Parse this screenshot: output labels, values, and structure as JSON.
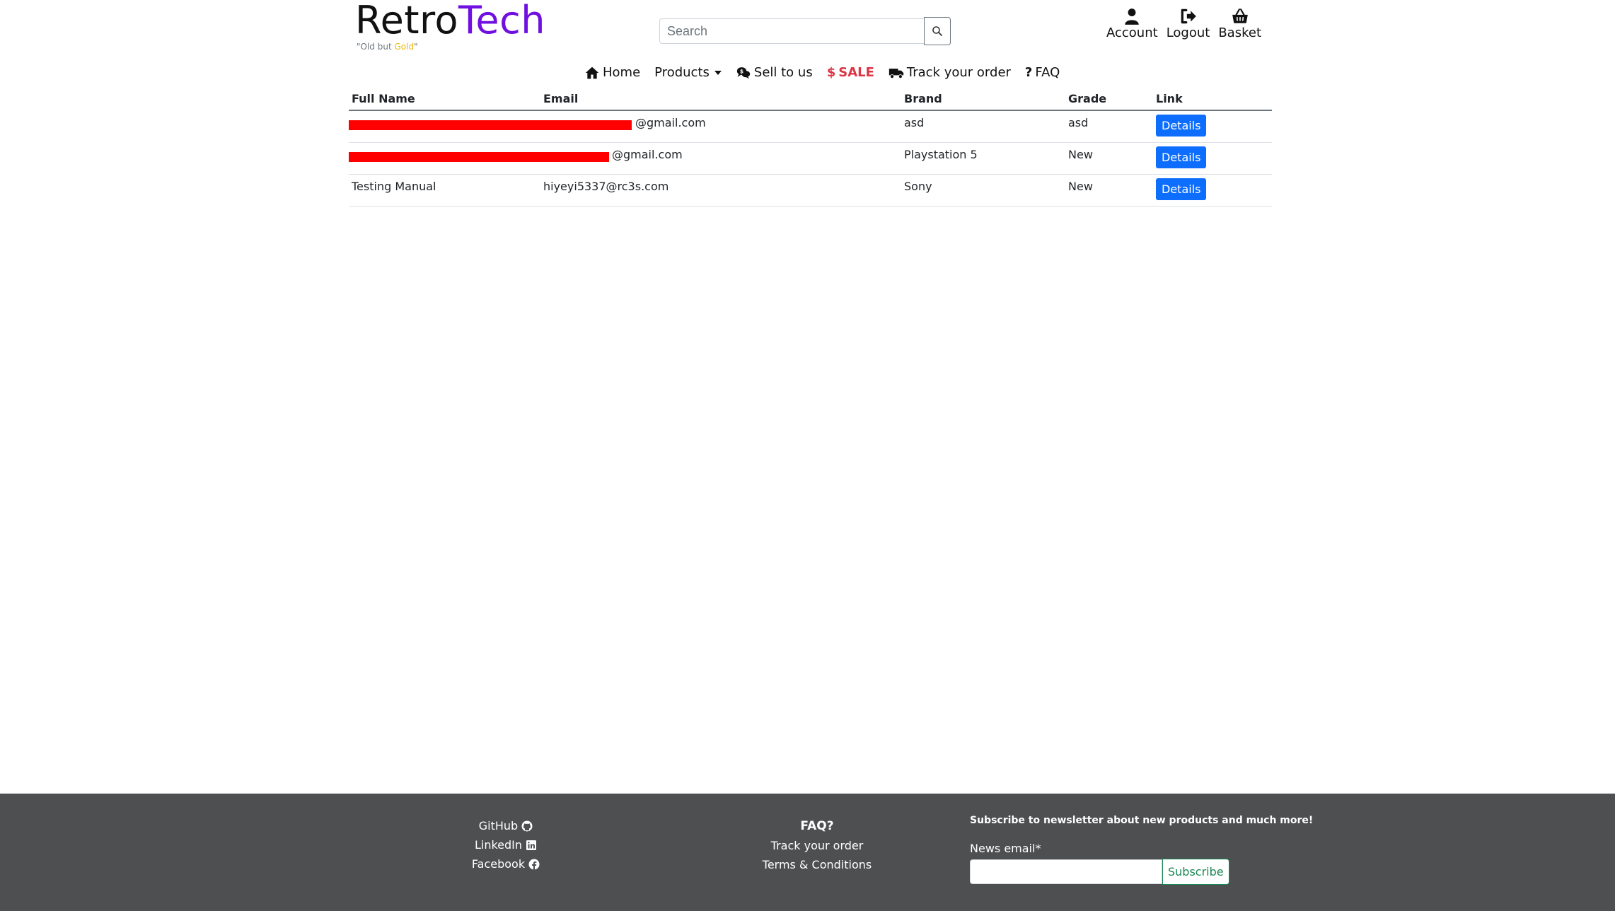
{
  "header": {
    "logo_part1": "Retro",
    "logo_part2": "Tech",
    "tagline_prefix": "\"Old but ",
    "tagline_gold": "Gold",
    "tagline_suffix": "\"",
    "search_placeholder": "Search",
    "account_label": "Account",
    "logout_label": "Logout",
    "basket_label": "Basket"
  },
  "nav": {
    "home": "Home",
    "products": "Products",
    "sell": "Sell to us",
    "sale": "SALE",
    "track": "Track your order",
    "faq": "FAQ"
  },
  "table": {
    "headers": [
      "Full Name",
      "Email",
      "Brand",
      "Grade",
      "Link"
    ],
    "rows": [
      {
        "name": "",
        "email": "@gmail.com",
        "brand": "asd",
        "grade": "asd",
        "link": "Details"
      },
      {
        "name": "",
        "email": "@gmail.com",
        "brand": "Playstation 5",
        "grade": "New",
        "link": "Details"
      },
      {
        "name": "Testing Manual",
        "email": "hiyeyi5337@rc3s.com",
        "brand": "Sony",
        "grade": "New",
        "link": "Details"
      }
    ]
  },
  "footer": {
    "github": "GitHub",
    "linkedin": "LinkedIn",
    "facebook": "Facebook",
    "faq": "FAQ?",
    "track": "Track your order",
    "terms": "Terms & Conditions",
    "newsletter_title": "Subscribe to newsletter about new products and much more!",
    "news_label": "News email*",
    "subscribe": "Subscribe"
  },
  "colors": {
    "brand_purple": "#6f10e0",
    "gold": "#e8b80c",
    "sale_red": "#dc3545",
    "button_blue": "#0d6efd",
    "footer_bg": "#4d4f51",
    "redaction": "#ff0000"
  }
}
